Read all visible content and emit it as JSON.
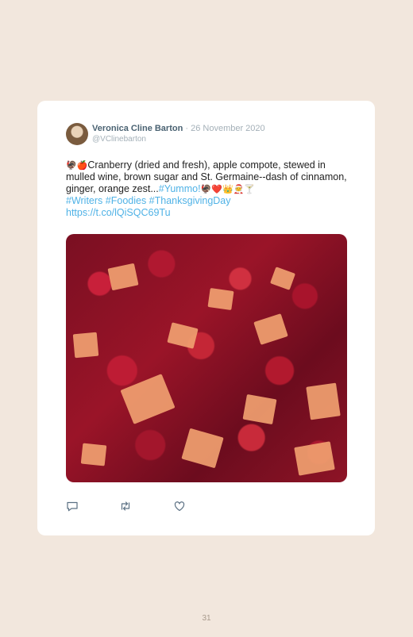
{
  "tweet": {
    "author_name": "Veronica Cline Barton",
    "separator": " · ",
    "date": "26 November 2020",
    "handle": "@VClinebarton",
    "text_lead_emoji": "🦃🍎",
    "text_main": "Cranberry (dried and fresh), apple compote, stewed in mulled wine, brown sugar and St. Germaine--dash of cinnamon, ginger, orange zest...",
    "hashtag_1": "#Yummo!",
    "trail_emoji": "🦃❤️👑🧑‍🎄🍸",
    "hashtags_line": "#Writers #Foodies #ThanksgivingDay",
    "url": "https://t.co/lQiSQC69Tu",
    "image_icon": "cranberry-compote-photo",
    "actions": {
      "reply_icon": "reply-icon",
      "retweet_icon": "retweet-icon",
      "like_icon": "heart-icon"
    }
  },
  "page": {
    "number": "31"
  }
}
